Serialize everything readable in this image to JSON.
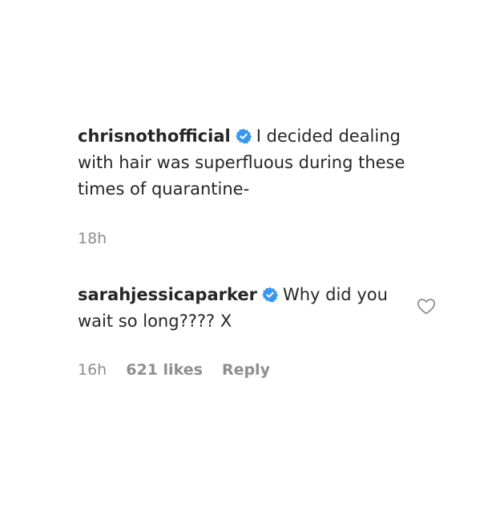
{
  "comments": [
    {
      "username": "chrisnothofficial",
      "verified": true,
      "text": "I decided dealing with hair was superfluous during these times of quarantine-",
      "time": "18h"
    },
    {
      "username": "sarahjessicaparker",
      "verified": true,
      "text": "Why did you wait so long???? X",
      "time": "16h",
      "likes": "621 likes",
      "reply_label": "Reply",
      "icon": "heart-outline-icon"
    }
  ],
  "colors": {
    "text": "#262626",
    "secondary": "#8e8e8e",
    "verified_badge": "#3897f0"
  }
}
